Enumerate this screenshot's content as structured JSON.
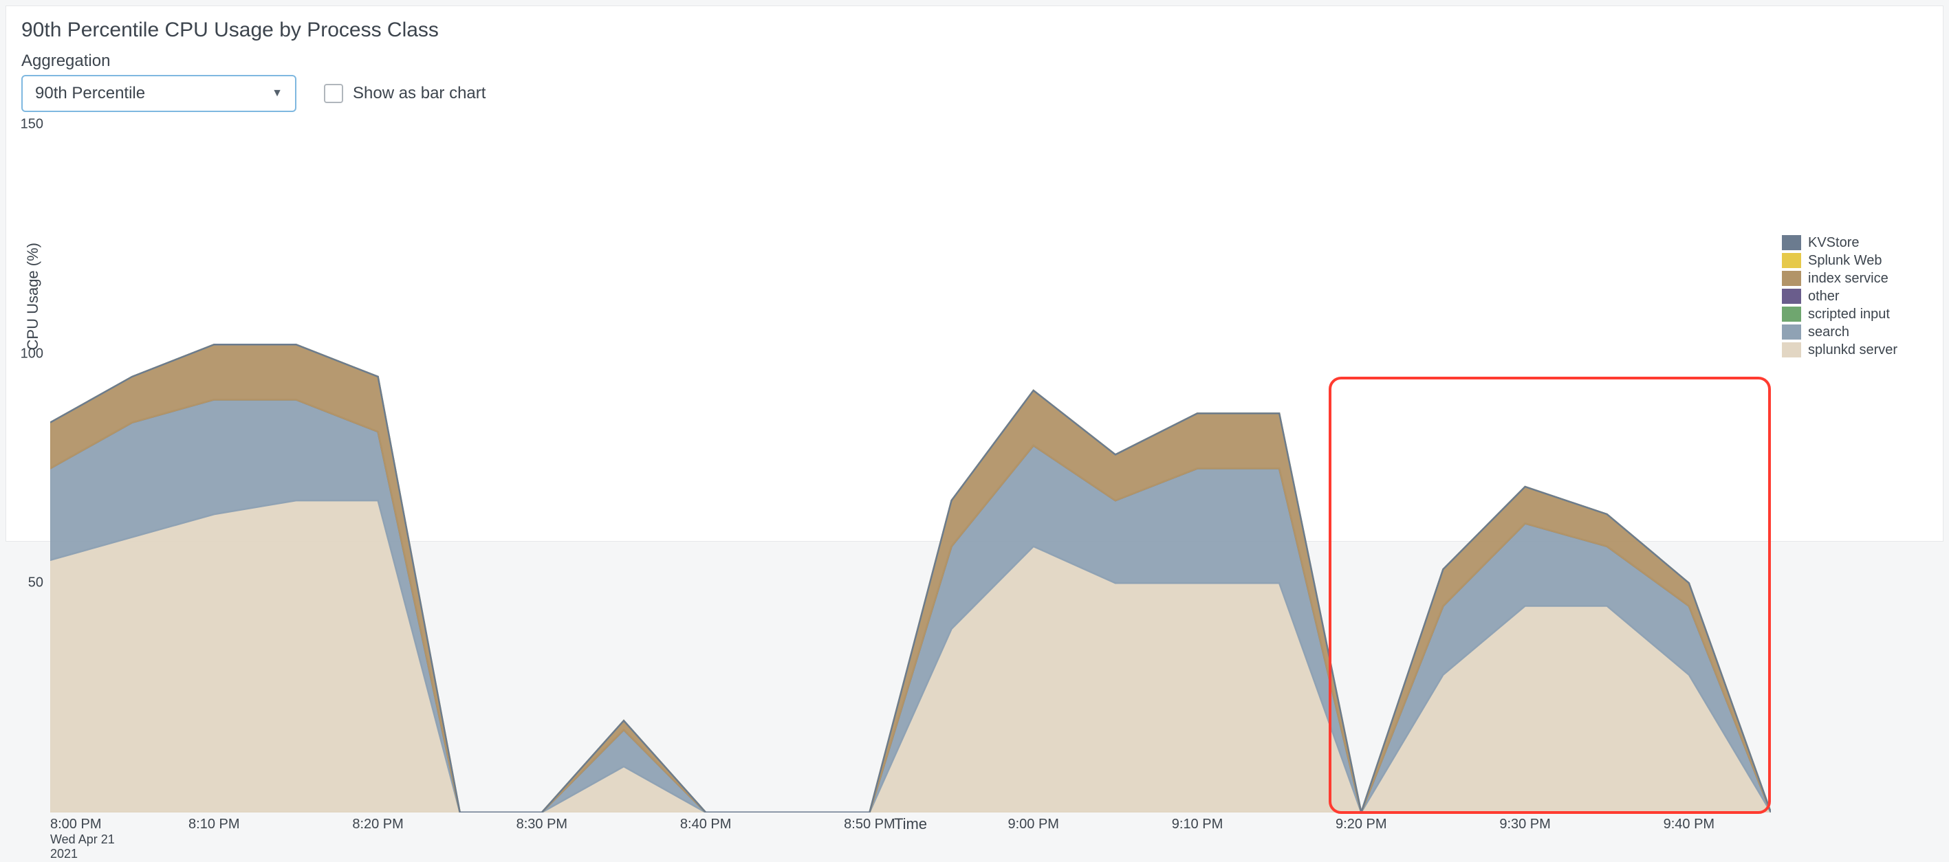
{
  "title": "90th Percentile CPU Usage by Process Class",
  "controls": {
    "aggregation_label": "Aggregation",
    "aggregation_value": "90th Percentile",
    "bar_chart_label": "Show as bar chart",
    "bar_chart_checked": false
  },
  "legend": {
    "items": [
      {
        "name": "KVStore",
        "color": "#6b7b8f"
      },
      {
        "name": "Splunk Web",
        "color": "#e6c94a"
      },
      {
        "name": "index service",
        "color": "#b29468"
      },
      {
        "name": "other",
        "color": "#6a5d8c"
      },
      {
        "name": "scripted input",
        "color": "#6fa66f"
      },
      {
        "name": "search",
        "color": "#8fa2b4"
      },
      {
        "name": "splunkd server",
        "color": "#e2d6c3"
      }
    ]
  },
  "chart_data": {
    "type": "area",
    "stacked": true,
    "xlabel": "Time",
    "ylabel": "CPU Usage (%)",
    "ylim": [
      0,
      150
    ],
    "yticks": [
      50,
      100,
      150
    ],
    "x_categories": [
      "8:00 PM",
      "8:05 PM",
      "8:10 PM",
      "8:15 PM",
      "8:20 PM",
      "8:25 PM",
      "8:30 PM",
      "8:35 PM",
      "8:40 PM",
      "8:45 PM",
      "8:50 PM",
      "8:55 PM",
      "9:00 PM",
      "9:05 PM",
      "9:10 PM",
      "9:15 PM",
      "9:20 PM",
      "9:25 PM",
      "9:30 PM",
      "9:35 PM",
      "9:40 PM",
      "9:45 PM"
    ],
    "x_tick_labels": [
      "8:00 PM",
      "8:10 PM",
      "8:20 PM",
      "8:30 PM",
      "8:40 PM",
      "8:50 PM",
      "9:00 PM",
      "9:10 PM",
      "9:20 PM",
      "9:30 PM",
      "9:40 PM"
    ],
    "x_date_sub": [
      "Wed Apr 21",
      "2021"
    ],
    "series": [
      {
        "name": "splunkd server",
        "color": "#e2d6c3",
        "values": [
          55,
          60,
          65,
          68,
          68,
          0,
          0,
          10,
          0,
          0,
          0,
          40,
          58,
          50,
          50,
          50,
          0,
          30,
          45,
          45,
          30,
          0
        ]
      },
      {
        "name": "search",
        "color": "#8fa2b4",
        "values": [
          20,
          25,
          25,
          22,
          15,
          0,
          0,
          8,
          0,
          0,
          0,
          18,
          22,
          18,
          25,
          25,
          0,
          15,
          18,
          13,
          15,
          0
        ]
      },
      {
        "name": "scripted input",
        "color": "#6fa66f",
        "values": [
          0,
          0,
          0,
          0,
          0,
          0,
          0,
          0,
          0,
          0,
          0,
          0,
          0,
          0,
          0,
          0,
          0,
          0,
          0,
          0,
          0,
          0
        ]
      },
      {
        "name": "other",
        "color": "#6a5d8c",
        "values": [
          0,
          0,
          0,
          0,
          0,
          0,
          0,
          0,
          0,
          0,
          0,
          0,
          0,
          0,
          0,
          0,
          0,
          0,
          0,
          0,
          0,
          0
        ]
      },
      {
        "name": "index service",
        "color": "#b29468",
        "values": [
          10,
          10,
          12,
          12,
          12,
          0,
          0,
          2,
          0,
          0,
          0,
          10,
          12,
          10,
          12,
          12,
          0,
          8,
          8,
          7,
          5,
          0
        ]
      },
      {
        "name": "Splunk Web",
        "color": "#e6c94a",
        "values": [
          0,
          0,
          0,
          0,
          0,
          0,
          0,
          0,
          0,
          0,
          0,
          0,
          0,
          0,
          0,
          0,
          0,
          0,
          0,
          0,
          0,
          0
        ]
      },
      {
        "name": "KVStore",
        "color": "#6b7b8f",
        "values": [
          0,
          0,
          0,
          0,
          0,
          0,
          0,
          0,
          0,
          0,
          0,
          0,
          0,
          0,
          0,
          0,
          0,
          0,
          0,
          0,
          0,
          0
        ]
      }
    ],
    "highlight_x_range": [
      "9:18 PM",
      "9:45 PM"
    ],
    "highlight_y_range": [
      0,
      95
    ]
  }
}
